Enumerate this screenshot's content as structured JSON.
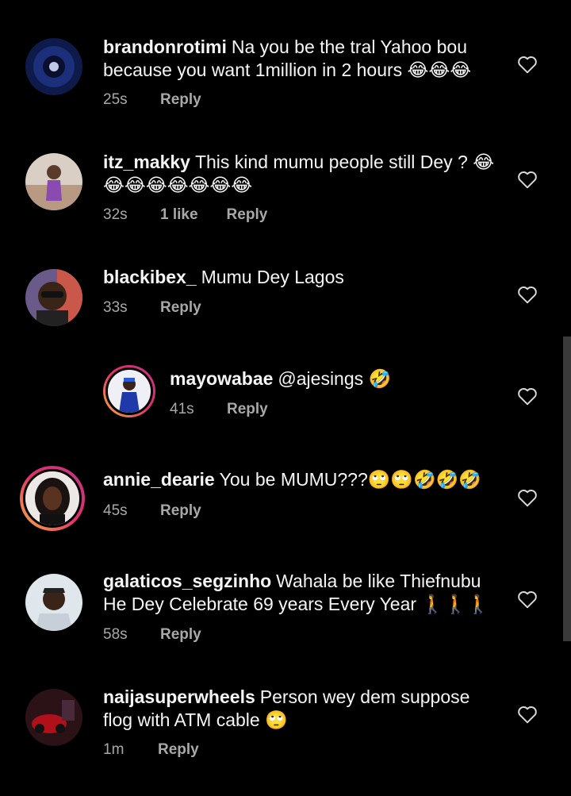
{
  "comments": [
    {
      "username": "brandonrotimi",
      "text": "Na you be the tral Yahoo bou because you want 1million in 2 hours 😂😂😂",
      "time": "25s",
      "likes": "",
      "reply": "Reply"
    },
    {
      "username": "itz_makky",
      "text": "This kind mumu people still Dey ? 😂😂😂😂😂😂😂😂",
      "time": "32s",
      "likes": "1 like",
      "reply": "Reply"
    },
    {
      "username": "blackibex_",
      "text": "Mumu Dey Lagos",
      "time": "33s",
      "likes": "",
      "reply": "Reply"
    },
    {
      "username": "mayowabae",
      "text": "@ajesings 🤣",
      "time": "41s",
      "likes": "",
      "reply": "Reply"
    },
    {
      "username": "annie_dearie",
      "text": "You be MUMU???🙄🙄🤣🤣🤣",
      "time": "45s",
      "likes": "",
      "reply": "Reply"
    },
    {
      "username": "galaticos_segzinho",
      "text": "Wahala be like Thiefnubu He Dey Celebrate 69 years Every Year 🚶🚶🚶",
      "time": "58s",
      "likes": "",
      "reply": "Reply"
    },
    {
      "username": "naijasuperwheels",
      "text": "Person wey dem suppose flog with ATM cable 🙄",
      "time": "1m",
      "likes": "",
      "reply": "Reply"
    }
  ],
  "icons": {
    "like": "heart-outline-icon"
  },
  "colors": {
    "background": "#000000",
    "text": "#f5f5f5",
    "secondary_text": "#a8a8a8",
    "story_ring_start": "#f9b43a",
    "story_ring_end": "#c13584"
  }
}
